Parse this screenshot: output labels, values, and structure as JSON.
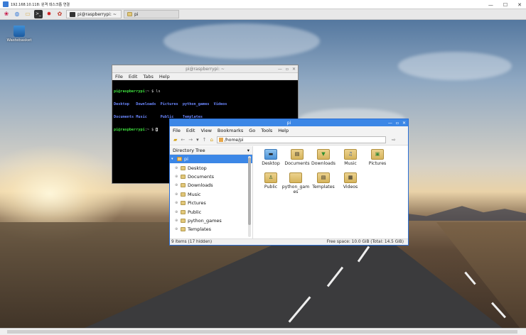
{
  "rdp": {
    "title": "192.168.10.118: 원격 데스크톱 연결",
    "controls": [
      "—",
      "☐",
      "✕"
    ]
  },
  "taskbar": {
    "launchers": [
      {
        "icon": "raspberry-menu-icon",
        "glyph": "❀",
        "color": "#c51a4a"
      },
      {
        "icon": "web-browser-icon",
        "glyph": "◍",
        "color": "#3b7dd8"
      },
      {
        "icon": "file-manager-icon",
        "glyph": "▭",
        "color": "#d8b25a"
      },
      {
        "icon": "terminal-icon",
        "glyph": ">_",
        "color": "#333333"
      },
      {
        "icon": "mathematica-icon",
        "glyph": "✸",
        "color": "#d11a1a"
      },
      {
        "icon": "wolfram-icon",
        "glyph": "✿",
        "color": "#c0392b"
      }
    ],
    "tasks": [
      {
        "label": "pi@raspberrypi: ~",
        "icon": "terminal-icon",
        "active": false
      },
      {
        "label": "pi",
        "icon": "folder-icon",
        "active": true
      }
    ]
  },
  "desktop": {
    "wastebasket_label": "Wastebasket"
  },
  "terminal": {
    "title": "pi@raspberrypi: ~",
    "menu": [
      "File",
      "Edit",
      "Tabs",
      "Help"
    ],
    "controls": [
      "—",
      "▫",
      "✕"
    ],
    "prompt": "pi@raspberrypi",
    "prompt_suffix": ":~ $ ",
    "command": "ls",
    "listing_row1": [
      "Desktop",
      "Downloads",
      "Pictures",
      "python_games",
      "Videos"
    ],
    "listing_row2": [
      "Documents",
      "Music",
      "Public",
      "Templates"
    ]
  },
  "filemanager": {
    "title": "pi",
    "controls": [
      "—",
      "▫",
      "✕"
    ],
    "menu": [
      "File",
      "Edit",
      "View",
      "Bookmarks",
      "Go",
      "Tools",
      "Help"
    ],
    "path": "/home/pi",
    "sidebar_header": "Directory Tree",
    "tree_root": "pi",
    "tree": [
      "Desktop",
      "Documents",
      "Downloads",
      "Music",
      "Pictures",
      "Public",
      "python_games",
      "Templates"
    ],
    "items": [
      {
        "label": "Desktop",
        "icon": "desktop-folder-icon",
        "glyph": "▬"
      },
      {
        "label": "Documents",
        "icon": "documents-folder-icon",
        "glyph": "▤"
      },
      {
        "label": "Downloads",
        "icon": "downloads-folder-icon",
        "glyph": "▼"
      },
      {
        "label": "Music",
        "icon": "music-folder-icon",
        "glyph": "♫"
      },
      {
        "label": "Pictures",
        "icon": "pictures-folder-icon",
        "glyph": "▣"
      },
      {
        "label": "Public",
        "icon": "public-folder-icon",
        "glyph": "♙"
      },
      {
        "label": "python_games",
        "icon": "folder-icon",
        "glyph": ""
      },
      {
        "label": "Templates",
        "icon": "templates-folder-icon",
        "glyph": "▤"
      },
      {
        "label": "Videos",
        "icon": "videos-folder-icon",
        "glyph": "▦"
      }
    ],
    "status_left": "9 items (17 hidden)",
    "status_right": "Free space: 10.0 GiB (Total: 14.5 GiB)"
  },
  "colors": {
    "accent_blue": "#3c87e6",
    "terminal_green": "#3ee03e",
    "terminal_blue": "#6b87ff"
  }
}
